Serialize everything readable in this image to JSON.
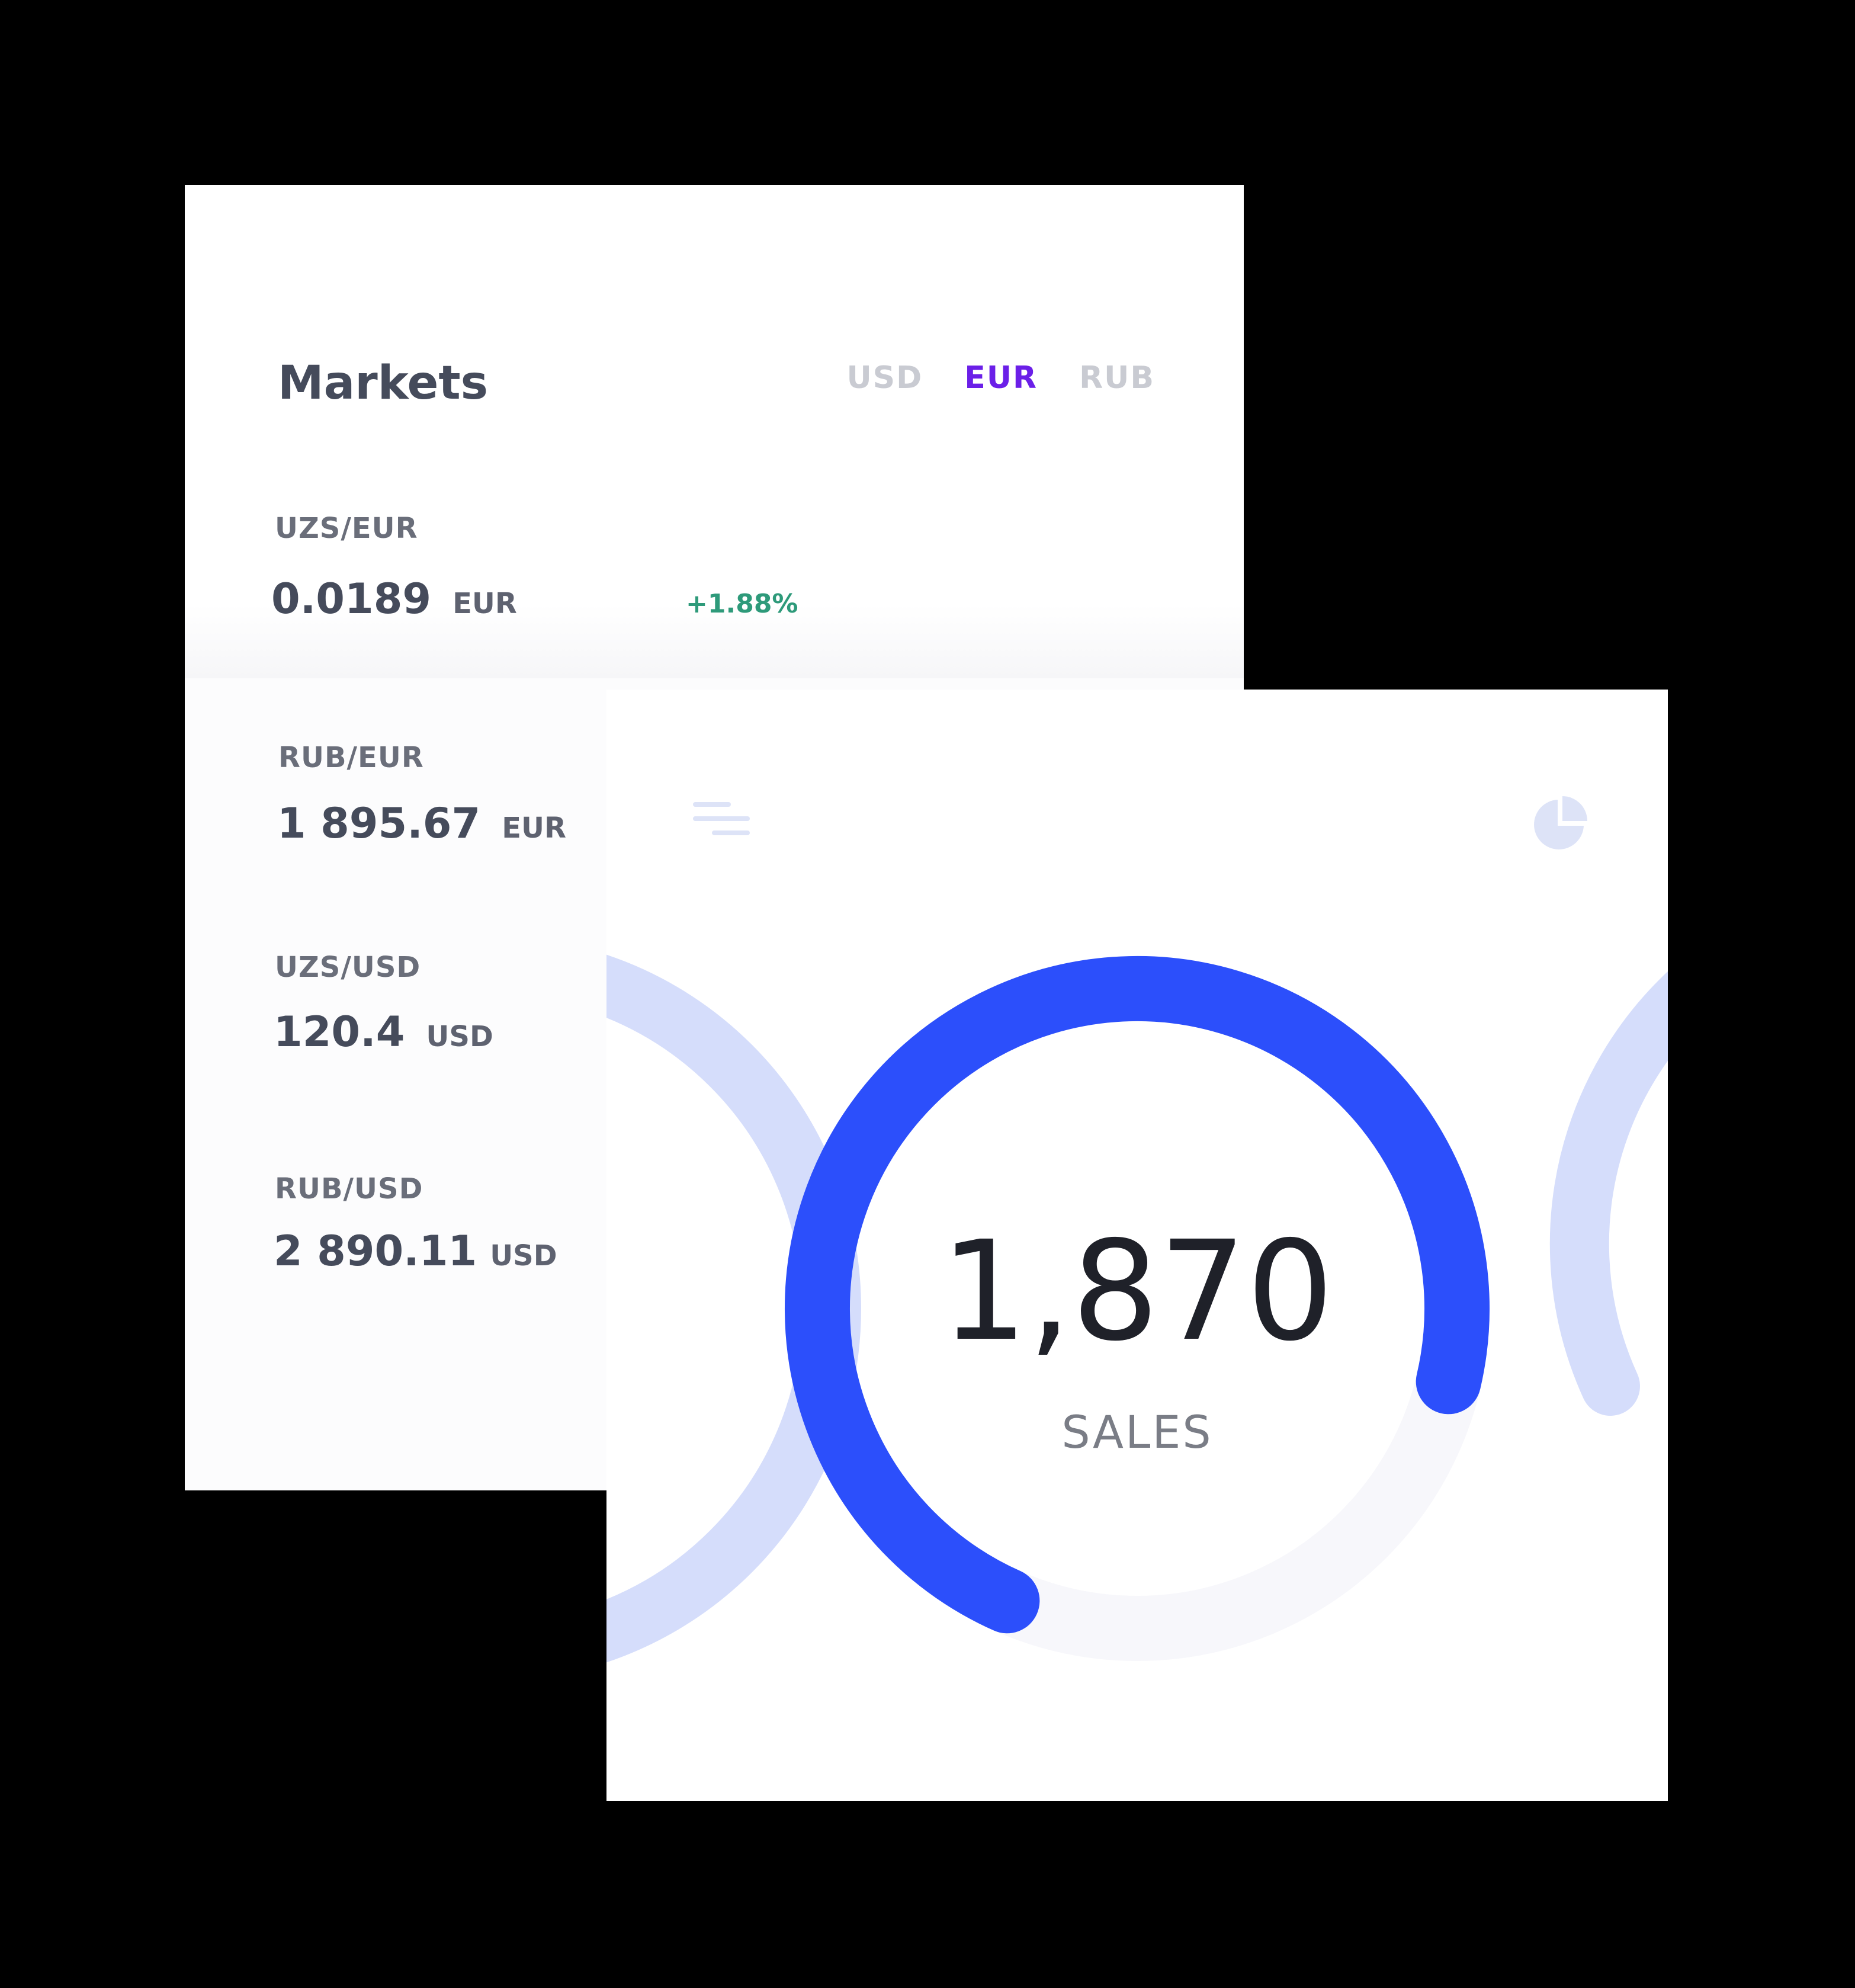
{
  "markets": {
    "title": "Markets",
    "tabs": [
      {
        "label": "USD",
        "active": false
      },
      {
        "label": "EUR",
        "active": true
      },
      {
        "label": "RUB",
        "active": false
      }
    ],
    "rows": [
      {
        "pair": "UZS/EUR",
        "value": "0.0189",
        "unit": "EUR",
        "change": "+1.88%"
      },
      {
        "pair": "RUB/EUR",
        "value": "1 895.67",
        "unit": "EUR"
      },
      {
        "pair": "UZS/USD",
        "value": "120.4",
        "unit": "USD"
      },
      {
        "pair": "RUB/USD",
        "value": "2 890.11",
        "unit": "USD"
      }
    ],
    "colors": {
      "active_tab": "#6b1fe8",
      "change_positive": "#2e9a7a",
      "sparkline": "#2e9a7a"
    }
  },
  "sales": {
    "value": "1,870",
    "label": "SALES",
    "gauge_progress_fraction": 0.72,
    "colors": {
      "gauge_fill": "#2c4ffb",
      "gauge_track": "#f7f7fb",
      "side_gauges": "#d5ddfb",
      "icons": "#dde3f7"
    },
    "icons": [
      "filter-lines-icon",
      "pie-chart-icon"
    ]
  }
}
